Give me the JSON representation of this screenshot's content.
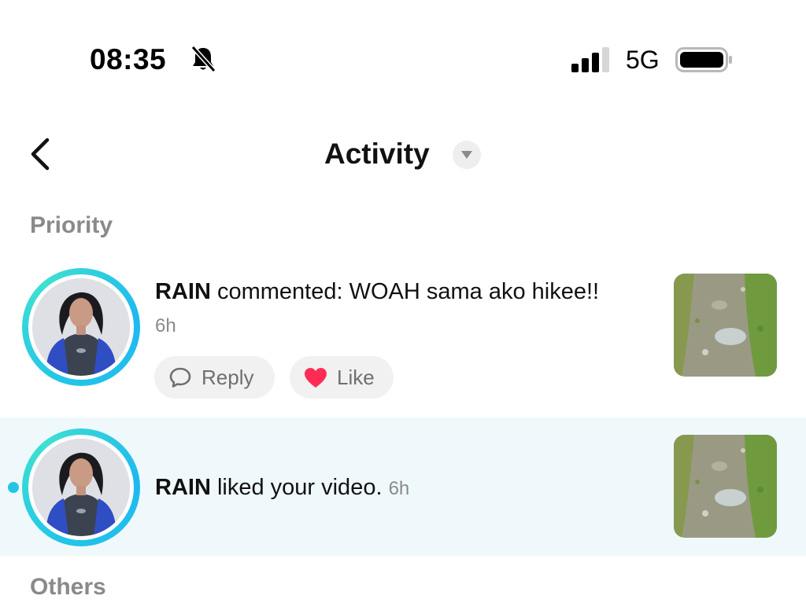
{
  "status_bar": {
    "time": "08:35",
    "network": "5G",
    "icons": [
      "bell-muted-icon",
      "signal-bars-icon",
      "battery-icon"
    ]
  },
  "header": {
    "title": "Activity",
    "icons": [
      "back-chevron-icon",
      "dropdown-caret-icon"
    ]
  },
  "sections": {
    "priority": "Priority",
    "others": "Others"
  },
  "notifications": [
    {
      "username": "RAIN",
      "message": " commented: WOAH sama ako hikee!! ",
      "time": "6h",
      "unread": false,
      "actions": {
        "reply": "Reply",
        "like": "Like"
      }
    },
    {
      "username": "RAIN",
      "message": " liked your video. ",
      "time": "6h",
      "unread": true
    }
  ],
  "colors": {
    "accent_ring": "#22c5e8",
    "unread_dot": "#25c4e6",
    "unread_row_bg": "#eff9fc",
    "like_heart": "#fe2c55",
    "muted_text": "#8a8a8a"
  }
}
